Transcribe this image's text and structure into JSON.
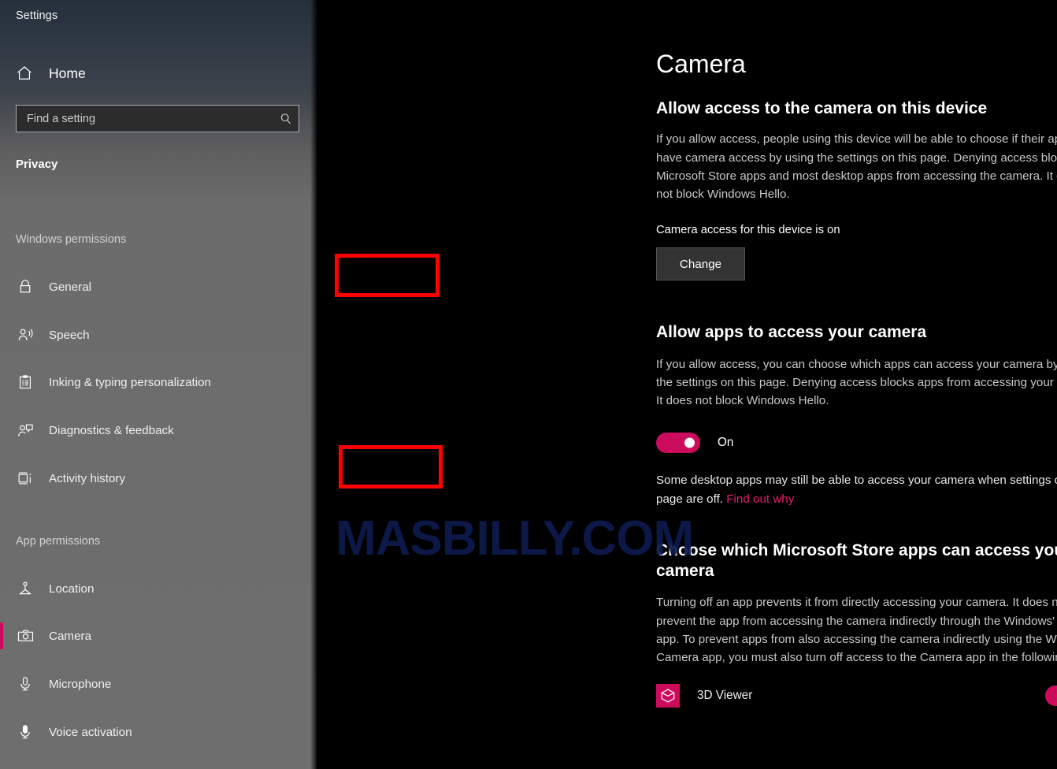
{
  "window": {
    "app_title": "Settings"
  },
  "sidebar": {
    "home": {
      "label": "Home",
      "icon": "home-icon"
    },
    "search": {
      "placeholder": "Find a setting",
      "value": "",
      "icon": "search-icon"
    },
    "section_title": "Privacy",
    "groups": [
      {
        "title": "Windows permissions",
        "items": [
          {
            "label": "General",
            "icon": "lock-icon",
            "selected": false
          },
          {
            "label": "Speech",
            "icon": "person-speech-waves-icon",
            "selected": false
          },
          {
            "label": "Inking & typing personalization",
            "icon": "clipboard-icon",
            "selected": false
          },
          {
            "label": "Diagnostics & feedback",
            "icon": "person-feedback-icon",
            "selected": false
          },
          {
            "label": "Activity history",
            "icon": "timeline-icon",
            "selected": false
          }
        ]
      },
      {
        "title": "App permissions",
        "items": [
          {
            "label": "Location",
            "icon": "location-pin-icon",
            "selected": false
          },
          {
            "label": "Camera",
            "icon": "camera-icon",
            "selected": true
          },
          {
            "label": "Microphone",
            "icon": "microphone-icon",
            "selected": false
          },
          {
            "label": "Voice activation",
            "icon": "voice-activation-icon",
            "selected": false
          }
        ]
      }
    ]
  },
  "main": {
    "page_title": "Camera",
    "device_section": {
      "heading": "Allow access to the camera on this device",
      "description": "If you allow access, people using this device will be able to choose if their apps have camera access by using the settings on this page. Denying access blocks Microsoft Store apps and most desktop apps from accessing the camera. It does not block Windows Hello.",
      "status": "Camera access for this device is on",
      "change_button": "Change"
    },
    "apps_section": {
      "heading": "Allow apps to access your camera",
      "description": "If you allow access, you can choose which apps can access your camera by using the settings on this page. Denying access blocks apps from accessing your camera. It does not block Windows Hello.",
      "toggle_state": "On",
      "note_prefix": "Some desktop apps may still be able to access your camera when settings on this page are off. ",
      "note_link": "Find out why"
    },
    "store_section": {
      "heading": "Choose which Microsoft Store apps can access your camera",
      "description": "Turning off an app prevents it from directly accessing your camera. It does not prevent the app from accessing the camera indirectly through the Windows' Camera app. To prevent apps from also accessing the camera indirectly using the Windows' Camera app, you must also turn off access to the Camera app in the following list.",
      "apps": [
        {
          "name": "3D Viewer",
          "toggle_state": "On",
          "icon": "3d-viewer-icon",
          "tile_color": "#cc0b5c"
        }
      ]
    }
  },
  "watermark": {
    "text": "MASBILLY.COM",
    "color": "#0d1a4d"
  },
  "colors": {
    "accent_pink": "#cc0b5c",
    "annotation_red": "#ff0000",
    "link_pink": "#e21b6b",
    "sidebar_gray": "#6e6e6e",
    "main_background": "#000000"
  }
}
